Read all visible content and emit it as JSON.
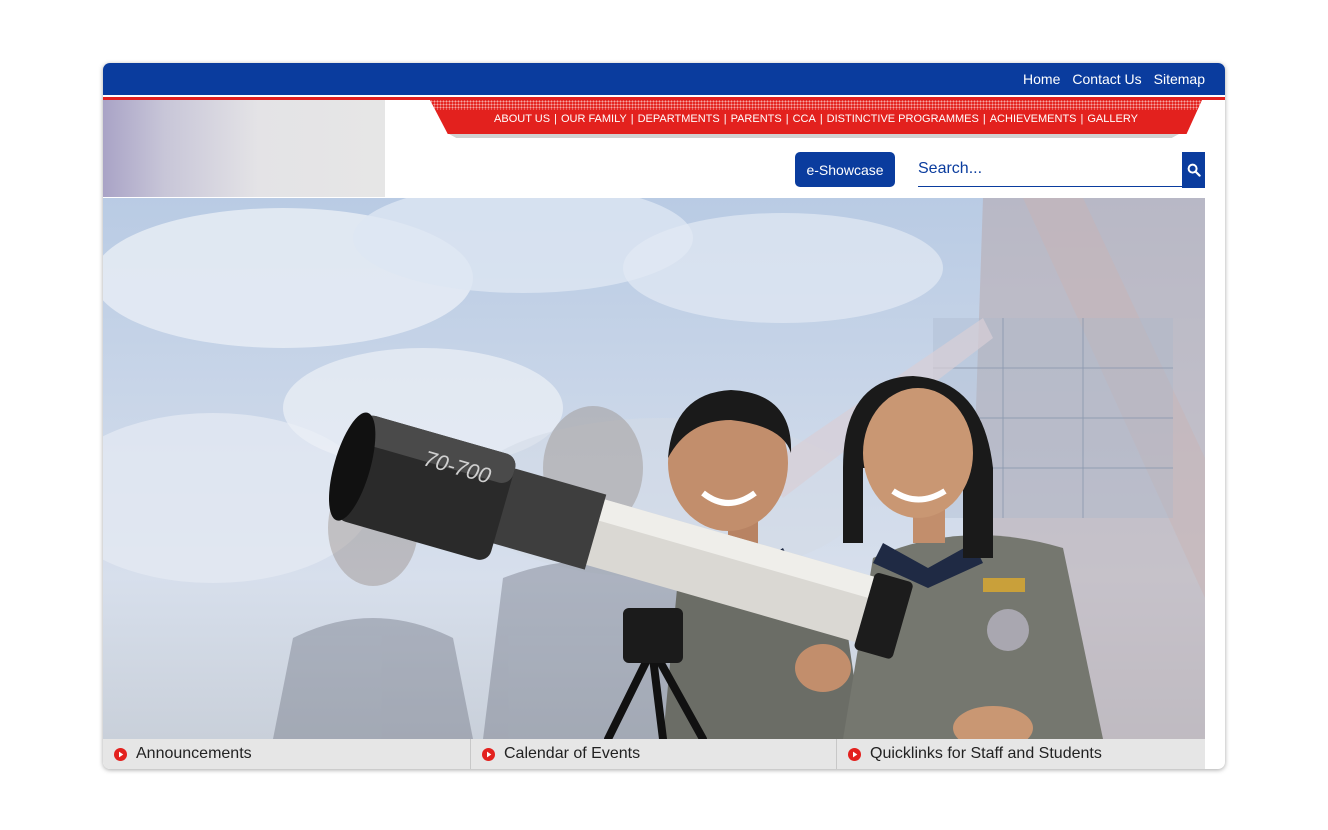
{
  "header": {
    "top_links": [
      "Home",
      "Contact Us",
      "Sitemap"
    ]
  },
  "nav": {
    "items": [
      "ABOUT US",
      "OUR FAMILY",
      "DEPARTMENTS",
      "PARENTS",
      "CCA",
      "DISTINCTIVE PROGRAMMES",
      "ACHIEVEMENTS",
      "GALLERY"
    ]
  },
  "actions": {
    "eshowcase_label": "e-Showcase"
  },
  "search": {
    "placeholder": "Search...",
    "icon": "search-icon"
  },
  "hero": {
    "telescope_text": "70-700"
  },
  "quicklinks": {
    "items": [
      "Announcements",
      "Calendar of Events",
      "Quicklinks for Staff and Students"
    ],
    "icon": "red-arrow-circle-icon"
  },
  "colors": {
    "brand_blue": "#0a3c9e",
    "brand_red": "#e3211e",
    "quicklink_bar": "#e6e6e6"
  }
}
